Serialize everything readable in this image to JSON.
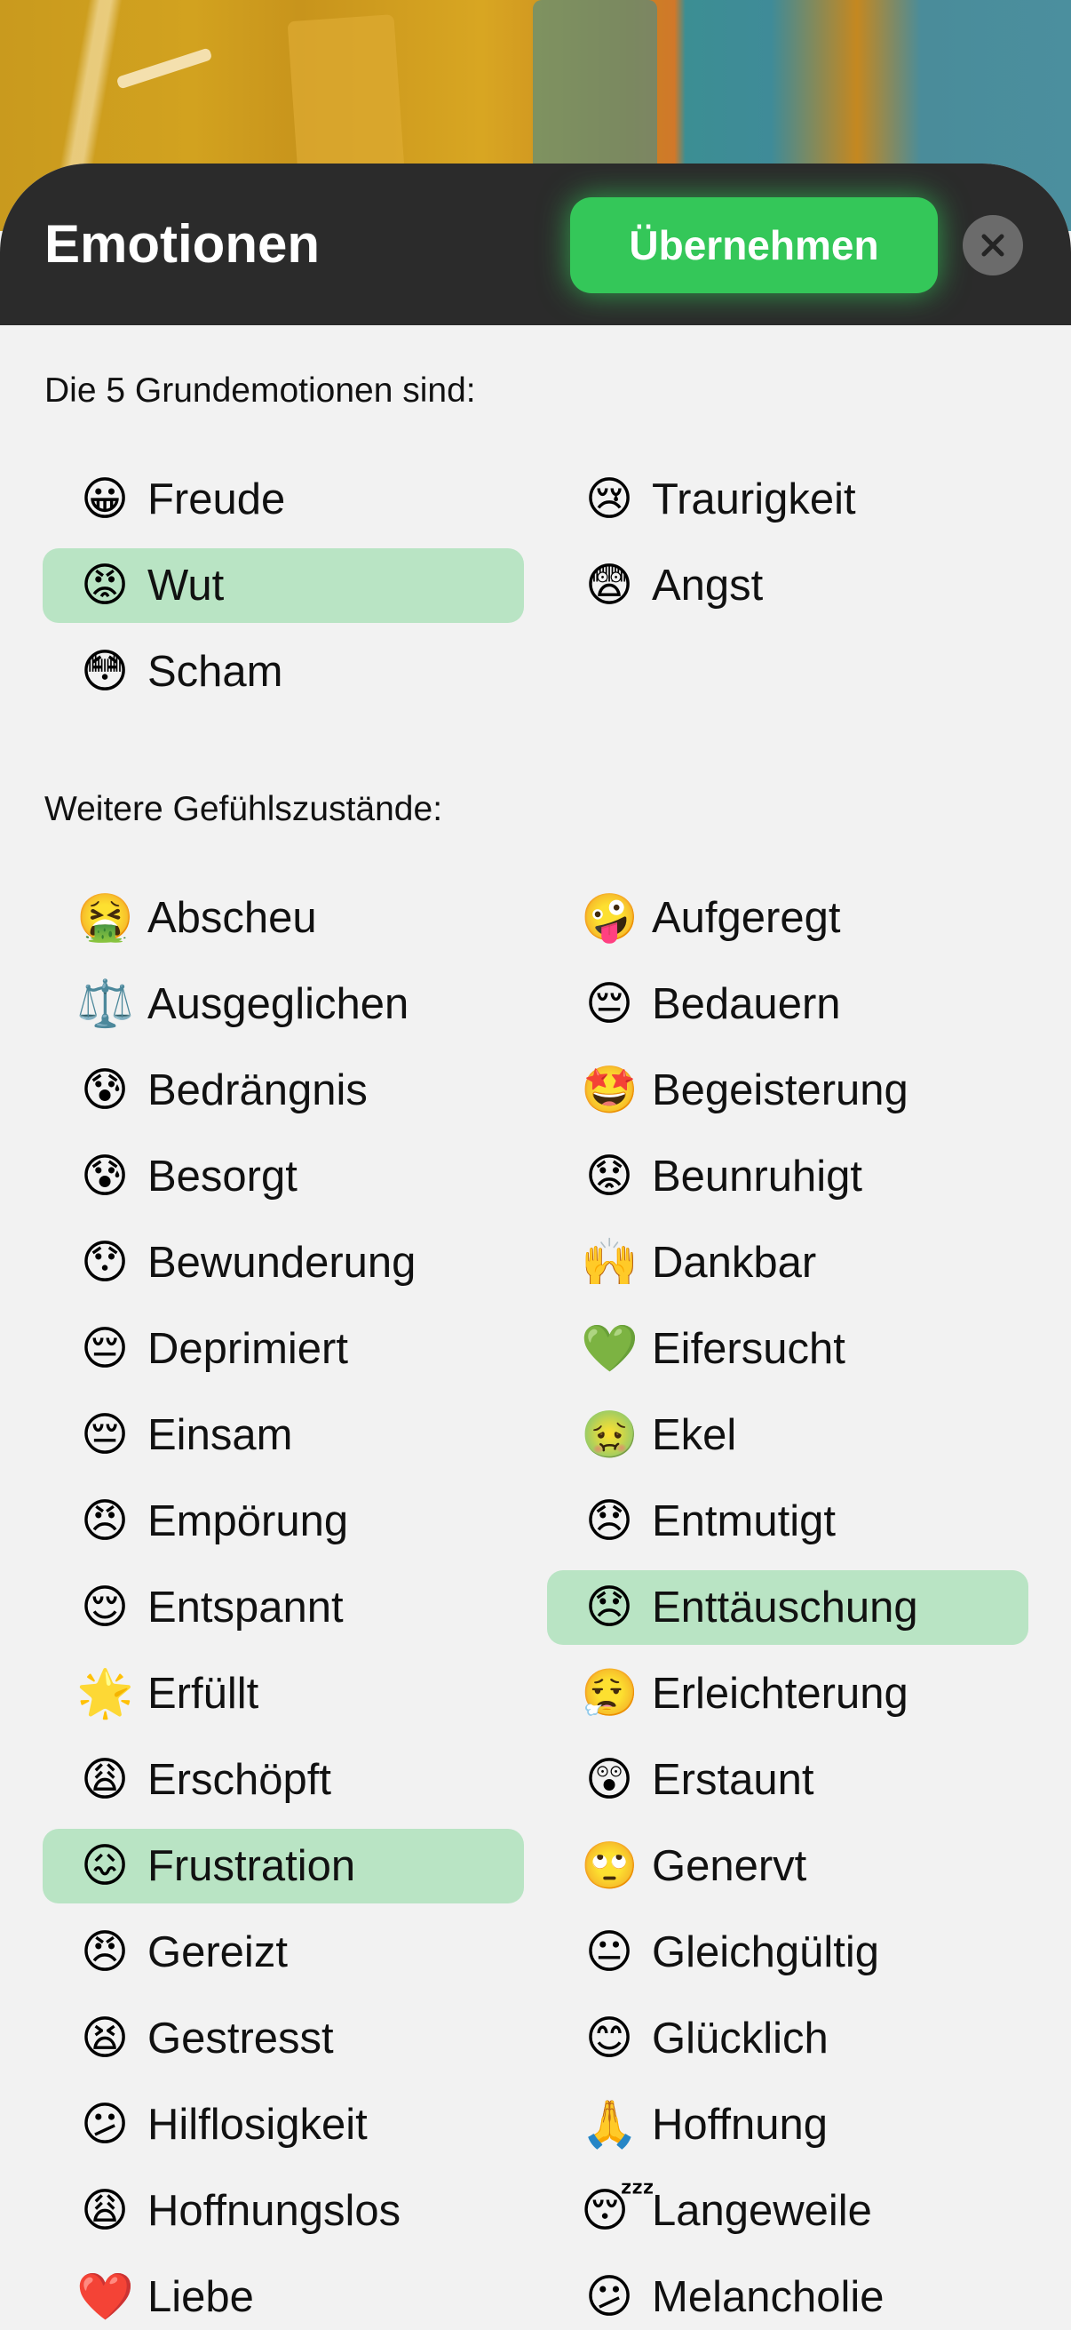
{
  "header": {
    "title": "Emotionen",
    "apply_label": "Übernehmen",
    "close_icon": "close-icon"
  },
  "colors": {
    "accent": "#34c759",
    "selected_background": "#b9e4c4",
    "header_background": "#2b2b2b"
  },
  "basic": {
    "heading": "Die 5 Grundemotionen sind:",
    "items": [
      {
        "emoji": "😀",
        "label": "Freude",
        "selected": false
      },
      {
        "emoji": "😢",
        "label": "Traurigkeit",
        "selected": false
      },
      {
        "emoji": "😡",
        "label": "Wut",
        "selected": true
      },
      {
        "emoji": "😨",
        "label": "Angst",
        "selected": false
      },
      {
        "emoji": "😳",
        "label": "Scham",
        "selected": false
      }
    ]
  },
  "more": {
    "heading": "Weitere Gefühlszustände:",
    "items": [
      {
        "emoji": "🤮",
        "label": "Abscheu",
        "selected": false
      },
      {
        "emoji": "🤪",
        "label": "Aufgeregt",
        "selected": false
      },
      {
        "emoji": "⚖️",
        "label": "Ausgeglichen",
        "selected": false
      },
      {
        "emoji": "😔",
        "label": "Bedauern",
        "selected": false
      },
      {
        "emoji": "😰",
        "label": "Bedrängnis",
        "selected": false
      },
      {
        "emoji": "🤩",
        "label": "Begeisterung",
        "selected": false
      },
      {
        "emoji": "😰",
        "label": "Besorgt",
        "selected": false
      },
      {
        "emoji": "😟",
        "label": "Beunruhigt",
        "selected": false
      },
      {
        "emoji": "😯",
        "label": "Bewunderung",
        "selected": false
      },
      {
        "emoji": "🙌",
        "label": "Dankbar",
        "selected": false
      },
      {
        "emoji": "😔",
        "label": "Deprimiert",
        "selected": false
      },
      {
        "emoji": "💚",
        "label": "Eifersucht",
        "selected": false
      },
      {
        "emoji": "😔",
        "label": "Einsam",
        "selected": false
      },
      {
        "emoji": "🤢",
        "label": "Ekel",
        "selected": false
      },
      {
        "emoji": "😠",
        "label": "Empörung",
        "selected": false
      },
      {
        "emoji": "😞",
        "label": "Entmutigt",
        "selected": false
      },
      {
        "emoji": "😌",
        "label": "Entspannt",
        "selected": false
      },
      {
        "emoji": "😞",
        "label": "Enttäuschung",
        "selected": true
      },
      {
        "emoji": "🌟",
        "label": "Erfüllt",
        "selected": false
      },
      {
        "emoji": "😮‍💨",
        "label": "Erleichterung",
        "selected": false
      },
      {
        "emoji": "😩",
        "label": "Erschöpft",
        "selected": false
      },
      {
        "emoji": "😲",
        "label": "Erstaunt",
        "selected": false
      },
      {
        "emoji": "😖",
        "label": "Frustration",
        "selected": true
      },
      {
        "emoji": "🙄",
        "label": "Genervt",
        "selected": false
      },
      {
        "emoji": "😠",
        "label": "Gereizt",
        "selected": false
      },
      {
        "emoji": "😐",
        "label": "Gleichgültig",
        "selected": false
      },
      {
        "emoji": "😫",
        "label": "Gestresst",
        "selected": false
      },
      {
        "emoji": "😊",
        "label": "Glücklich",
        "selected": false
      },
      {
        "emoji": "😕",
        "label": "Hilflosigkeit",
        "selected": false
      },
      {
        "emoji": "🙏",
        "label": "Hoffnung",
        "selected": false
      },
      {
        "emoji": "😩",
        "label": "Hoffnungslos",
        "selected": false
      },
      {
        "emoji": "😴",
        "label": "Langeweile",
        "selected": false
      },
      {
        "emoji": "❤️",
        "label": "Liebe",
        "selected": false
      },
      {
        "emoji": "😕",
        "label": "Melancholie",
        "selected": false
      }
    ]
  }
}
